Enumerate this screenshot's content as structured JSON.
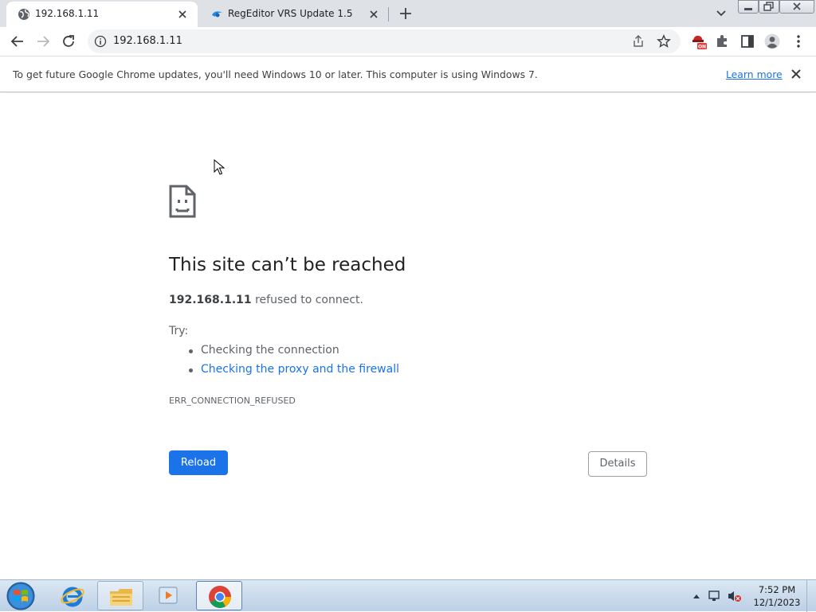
{
  "browser": {
    "tabs": [
      {
        "title": "192.168.1.11",
        "active": true
      },
      {
        "title": "RegEditor VRS Update 1.5",
        "active": false
      }
    ],
    "address_bar": {
      "url": "192.168.1.11"
    }
  },
  "infobar": {
    "message": "To get future Google Chrome updates, you'll need Windows 10 or later. This computer is using Windows 7.",
    "link_label": "Learn more"
  },
  "error_page": {
    "title": "This site can’t be reached",
    "host": "192.168.1.11",
    "summary_suffix": " refused to connect.",
    "try_label": "Try:",
    "suggestions": [
      "Checking the connection",
      "Checking the proxy and the firewall"
    ],
    "error_code": "ERR_CONNECTION_REFUSED",
    "reload_label": "Reload",
    "details_label": "Details"
  },
  "taskbar": {
    "time": "7:52 PM",
    "date": "12/1/2023"
  },
  "colors": {
    "accent": "#1a73e8",
    "tab_strip": "#dee1e6",
    "text_primary": "#202124",
    "text_secondary": "#5f6368"
  },
  "icons": [
    "globe-icon",
    "close-icon",
    "plus-icon",
    "chevron-down-icon",
    "back-arrow-icon",
    "forward-arrow-icon",
    "reload-icon",
    "info-icon",
    "share-icon",
    "star-icon",
    "extension-on-icon",
    "puzzle-icon",
    "side-panel-icon",
    "profile-icon",
    "kebab-menu-icon",
    "sad-page-icon",
    "windows-start-icon",
    "internet-explorer-icon",
    "file-explorer-icon",
    "media-player-icon",
    "chrome-icon",
    "speaker-muted-icon",
    "network-icon"
  ]
}
